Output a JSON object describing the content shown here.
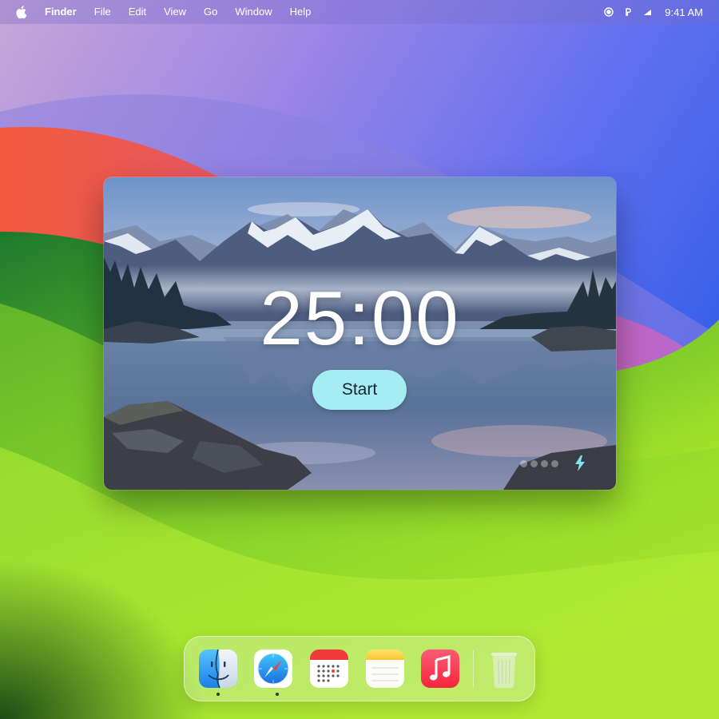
{
  "menubar": {
    "app_name": "Finder",
    "menus": [
      "File",
      "Edit",
      "View",
      "Go",
      "Window",
      "Help"
    ],
    "clock": "9:41 AM",
    "status_icons": [
      "record-icon",
      "p-icon",
      "wifi-icon"
    ]
  },
  "timer": {
    "time": "25:00",
    "start_label": "Start",
    "session_dots": 4,
    "colors": {
      "button": "#a5ecf3",
      "bolt": "#7fe3ee"
    }
  },
  "dock": {
    "items": [
      {
        "name": "finder-icon",
        "running": true
      },
      {
        "name": "safari-icon",
        "running": true
      },
      {
        "name": "calendar-icon",
        "running": false
      },
      {
        "name": "notes-icon",
        "running": false
      },
      {
        "name": "music-icon",
        "running": false
      },
      {
        "name": "trash-icon",
        "running": false
      }
    ]
  }
}
